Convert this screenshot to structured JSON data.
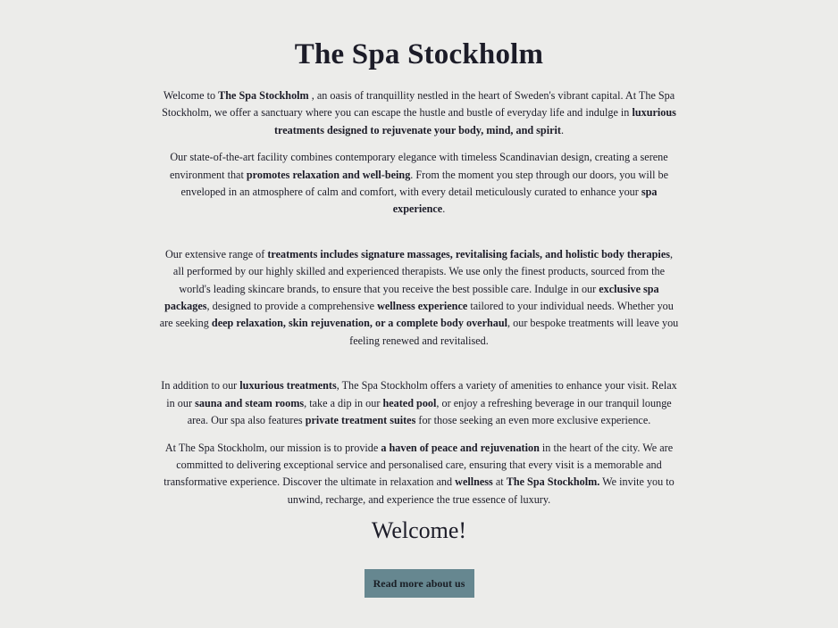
{
  "page": {
    "title": "The Spa Stockholm",
    "welcome_heading": "Welcome!",
    "cta_label": "Read more about us"
  },
  "paragraphs": [
    [
      {
        "t": "Welcome to ",
        "b": false
      },
      {
        "t": "The Spa Stockholm",
        "b": true
      },
      {
        "t": " , an oasis of tranquillity nestled in the heart of Sweden's vibrant capital. At The Spa Stockholm, we offer a sanctuary where you can escape the hustle and bustle of everyday life and indulge in ",
        "b": false
      },
      {
        "t": "luxurious treatments designed to rejuvenate your body, mind, and spirit",
        "b": true
      },
      {
        "t": ".",
        "b": false
      }
    ],
    [
      {
        "t": "Our state-of-the-art facility combines contemporary elegance with timeless Scandinavian design, creating a serene environment that ",
        "b": false
      },
      {
        "t": "promotes relaxation and well-being",
        "b": true
      },
      {
        "t": ". From the moment you step through our doors, you will be enveloped in an atmosphere of calm and comfort, with every detail meticulously curated to enhance your ",
        "b": false
      },
      {
        "t": "spa experience",
        "b": true
      },
      {
        "t": ".",
        "b": false
      }
    ],
    [
      {
        "t": "Our extensive range of ",
        "b": false
      },
      {
        "t": "treatments includes signature massages, revitalising facials, and holistic body therapies",
        "b": true
      },
      {
        "t": ", all performed by our highly skilled and experienced therapists. We use only the finest products, sourced from the world's leading skincare brands, to ensure that you receive the best possible care. Indulge in our ",
        "b": false
      },
      {
        "t": "exclusive spa packages",
        "b": true
      },
      {
        "t": ", designed to provide a comprehensive ",
        "b": false
      },
      {
        "t": "wellness experience",
        "b": true
      },
      {
        "t": " tailored to your individual needs. Whether you are seeking ",
        "b": false
      },
      {
        "t": "deep relaxation, skin rejuvenation, or a complete body overhaul",
        "b": true
      },
      {
        "t": ", our bespoke treatments will leave you feeling renewed and revitalised.",
        "b": false
      }
    ],
    [
      {
        "t": "In addition to our ",
        "b": false
      },
      {
        "t": "luxurious treatments",
        "b": true
      },
      {
        "t": ", The Spa Stockholm offers a variety of amenities to enhance your visit. Relax in our ",
        "b": false
      },
      {
        "t": "sauna and steam rooms",
        "b": true
      },
      {
        "t": ", take a dip in our ",
        "b": false
      },
      {
        "t": "heated pool",
        "b": true
      },
      {
        "t": ", or enjoy a refreshing beverage in our tranquil lounge area. Our spa also features ",
        "b": false
      },
      {
        "t": "private treatment suites",
        "b": true
      },
      {
        "t": " for those seeking an even more exclusive experience.",
        "b": false
      }
    ],
    [
      {
        "t": "At The Spa Stockholm, our mission is to provide ",
        "b": false
      },
      {
        "t": "a haven of peace and rejuvenation",
        "b": true
      },
      {
        "t": " in the heart of the city. We are committed to delivering exceptional service and personalised care, ensuring that every visit is a memorable and transformative experience. Discover the ultimate in relaxation and ",
        "b": false
      },
      {
        "t": "wellness",
        "b": true
      },
      {
        "t": " at ",
        "b": false
      },
      {
        "t": "The Spa Stockholm.",
        "b": true
      },
      {
        "t": " We invite you to unwind, recharge, and experience the true essence of luxury.",
        "b": false
      }
    ]
  ]
}
